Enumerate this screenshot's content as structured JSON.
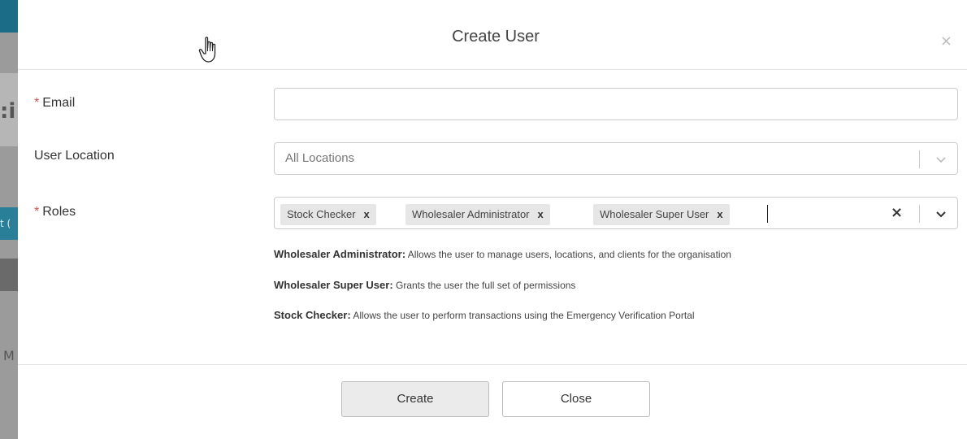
{
  "backdrop": {
    "glyph_1": ":i",
    "glyph_2": "t (",
    "glyph_3": "M"
  },
  "modal": {
    "title": "Create User",
    "close_symbol": "×"
  },
  "form": {
    "email": {
      "required_mark": "*",
      "label": "Email",
      "value": ""
    },
    "location": {
      "label": "User Location",
      "placeholder": "All Locations"
    },
    "roles": {
      "required_mark": "*",
      "label": "Roles",
      "tags": [
        {
          "label": "Stock Checker",
          "remove": "x"
        },
        {
          "label": "Wholesaler Administrator",
          "remove": "x"
        },
        {
          "label": "Wholesaler Super User",
          "remove": "x"
        }
      ],
      "clear_symbol": "×"
    }
  },
  "descriptions": [
    {
      "role": "Wholesaler Administrator:",
      "text": " Allows the user to manage users, locations, and clients for the organisation"
    },
    {
      "role": "Wholesaler Super User:",
      "text": " Grants the user the full set of permissions"
    },
    {
      "role": "Stock Checker:",
      "text": " Allows the user to perform transactions using the Emergency Verification Portal"
    }
  ],
  "buttons": {
    "create": "Create",
    "close": "Close"
  },
  "colors": {
    "required": "#d9534f",
    "tag_bg": "#e6e6e6",
    "create_bg": "#ebebeb"
  },
  "icons": [
    "pointer-hand-icon",
    "close-icon",
    "chevron-down-icon",
    "clear-icon"
  ]
}
